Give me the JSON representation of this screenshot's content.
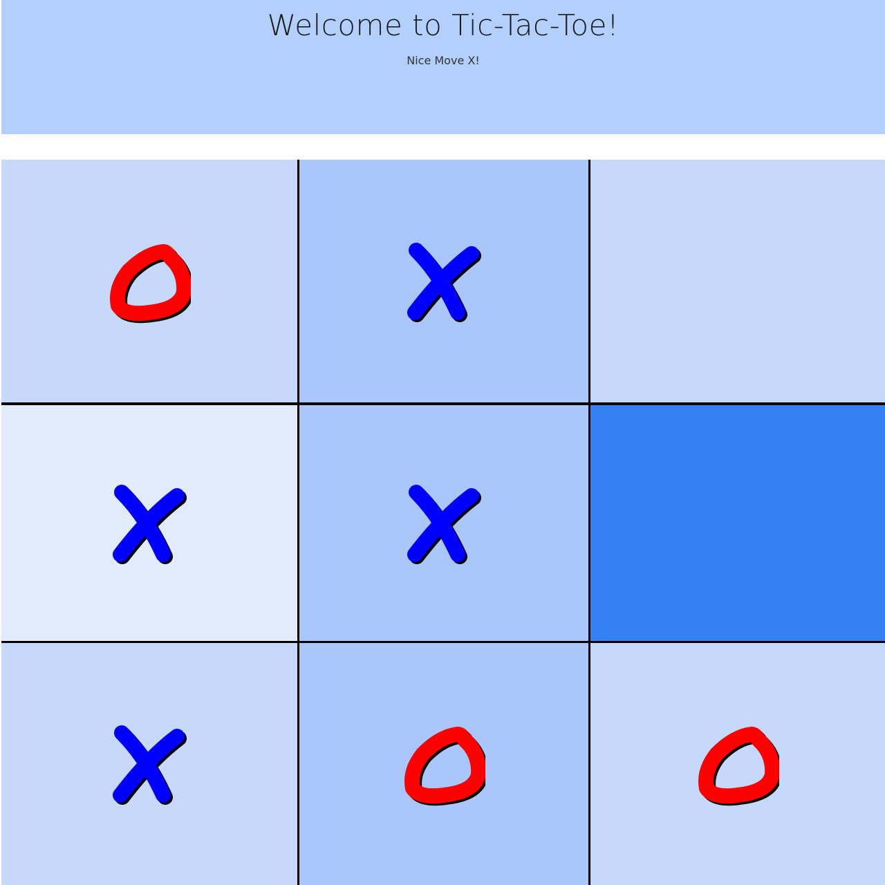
{
  "header": {
    "title": "Welcome to Tic-Tac-Toe!",
    "status": "Nice Move X!"
  },
  "board": {
    "cells": [
      {
        "row": 1,
        "col": 1,
        "mark": "O",
        "bg": "#c6d9fb"
      },
      {
        "row": 1,
        "col": 2,
        "mark": "X",
        "bg": "#a9c7fa"
      },
      {
        "row": 1,
        "col": 3,
        "mark": "",
        "bg": "#c6d9fb"
      },
      {
        "row": 2,
        "col": 1,
        "mark": "X",
        "bg": "#e1ebfc"
      },
      {
        "row": 2,
        "col": 2,
        "mark": "X",
        "bg": "#a9c7fa"
      },
      {
        "row": 2,
        "col": 3,
        "mark": "",
        "bg": "#3580f3"
      },
      {
        "row": 3,
        "col": 1,
        "mark": "X",
        "bg": "#c6d9fb"
      },
      {
        "row": 3,
        "col": 2,
        "mark": "O",
        "bg": "#a9c7fa"
      },
      {
        "row": 3,
        "col": 3,
        "mark": "O",
        "bg": "#c6d9fb"
      }
    ]
  },
  "colors": {
    "x_mark": "#0000ff",
    "o_mark": "#ff0000",
    "grid_line": "#000000",
    "header_bg": "#b3cffb"
  },
  "icons": {
    "x": "x-mark-icon",
    "o": "o-mark-icon"
  }
}
